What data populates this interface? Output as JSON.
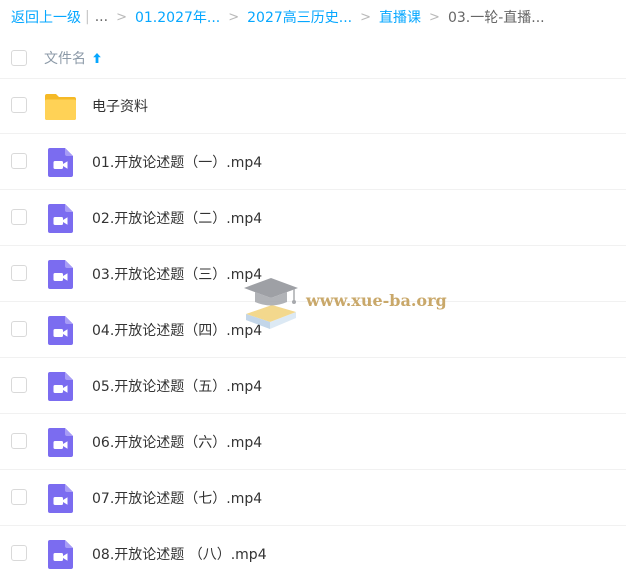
{
  "breadcrumb": {
    "back": "返回上一级",
    "separator_bar": "|",
    "ellipsis": "...",
    "arrow": ">",
    "items": [
      "01.2027年...",
      "2027高三历史...",
      "直播课"
    ],
    "current": "03.一轮-直播..."
  },
  "header": {
    "name_label": "文件名",
    "sort": "ascending"
  },
  "files": [
    {
      "name": "电子资料",
      "type": "folder"
    },
    {
      "name": "01.开放论述题（一）.mp4",
      "type": "video"
    },
    {
      "name": "02.开放论述题（二）.mp4",
      "type": "video"
    },
    {
      "name": "03.开放论述题（三）.mp4",
      "type": "video"
    },
    {
      "name": "04.开放论述题（四）.mp4",
      "type": "video"
    },
    {
      "name": "05.开放论述题（五）.mp4",
      "type": "video"
    },
    {
      "name": "06.开放论述题（六）.mp4",
      "type": "video"
    },
    {
      "name": "07.开放论述题（七）.mp4",
      "type": "video"
    },
    {
      "name": "08.开放论述题 （八）.mp4",
      "type": "video"
    }
  ],
  "watermark": {
    "text": "www.xue-ba.org",
    "icon": "graduation-cap-book-icon"
  },
  "colors": {
    "link": "#06a7ff",
    "folder": "#ffc83d",
    "video": "#7b6cf0",
    "text": "#333333",
    "muted": "#8c9aa8"
  },
  "icons": {
    "folder": "folder-icon",
    "video": "video-file-icon",
    "sort": "sort-up-arrow-icon"
  }
}
